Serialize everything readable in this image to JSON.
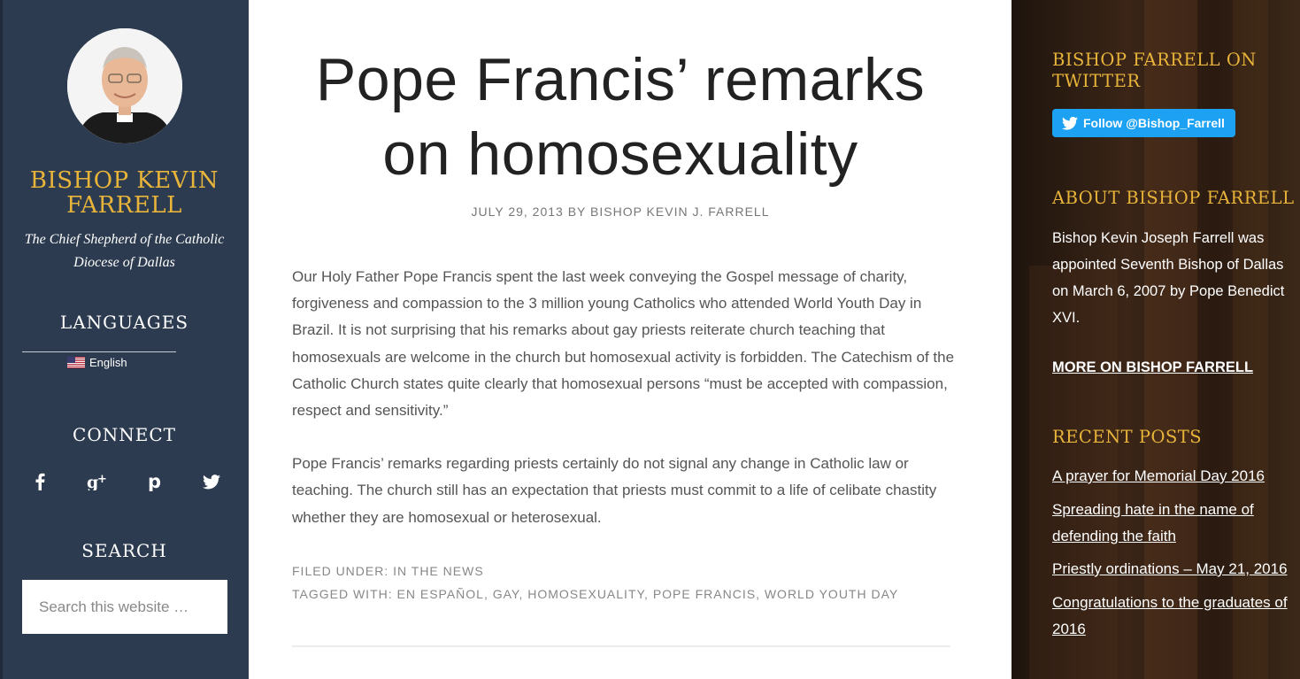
{
  "site": {
    "title": "BISHOP KEVIN FARRELL",
    "tagline": "The Chief Shepherd of the Catholic Diocese of Dallas"
  },
  "left_sidebar": {
    "languages_title": "LANGUAGES",
    "language_item": "English",
    "connect_title": "CONNECT",
    "social_icons": [
      "facebook-icon",
      "google-plus-icon",
      "pinterest-icon",
      "twitter-icon"
    ],
    "search_title": "SEARCH",
    "search_placeholder": "Search this website …"
  },
  "post": {
    "title": "Pope Francis’ remarks on homosexuality",
    "meta": "JULY 29, 2013 BY BISHOP KEVIN J. FARRELL",
    "paragraphs": [
      "Our Holy Father Pope Francis spent the last week conveying the Gospel message of charity, forgiveness and compassion to the 3 million young Catholics who attended World Youth Day in Brazil. It is not surprising that his remarks about gay priests reiterate church teaching that homosexuals are welcome in the church but homosexual activity is forbidden. The Catechism of the Catholic Church states quite clearly that homosexual persons “must be accepted with compassion, respect and sensitivity.”",
      "Pope Francis’ remarks regarding priests certainly do not signal any change in Catholic law or teaching. The church still has an expectation that priests must commit to a life of celibate chastity whether they are homosexual or heterosexual."
    ],
    "filed_under_label": "FILED UNDER: ",
    "filed_under": "IN THE NEWS",
    "tagged_with_label": "TAGGED WITH: ",
    "tags": [
      "EN ESPAÑOL",
      "GAY",
      "HOMOSEXUALITY",
      "POPE FRANCIS",
      "WORLD YOUTH DAY"
    ]
  },
  "right_sidebar": {
    "twitter_title": "BISHOP FARRELL ON TWITTER",
    "follow_button": "Follow @Bishop_Farrell",
    "about_title": "ABOUT BISHOP FARRELL",
    "about_text": "Bishop Kevin Joseph Farrell was appointed Seventh Bishop of Dallas on March 6, 2007 by Pope Benedict XVI.",
    "more_link": "MORE ON BISHOP FARRELL",
    "recent_title": "RECENT POSTS",
    "recent_posts": [
      "A prayer for Memorial Day 2016",
      "Spreading hate in the name of defending the faith",
      "Priestly ordinations – May 21, 2016",
      "Congratulations to the graduates of 2016"
    ]
  },
  "colors": {
    "sidebar_bg": "#2c3b4f",
    "accent_gold": "#e8b43a",
    "twitter_blue": "#1da1f2"
  }
}
